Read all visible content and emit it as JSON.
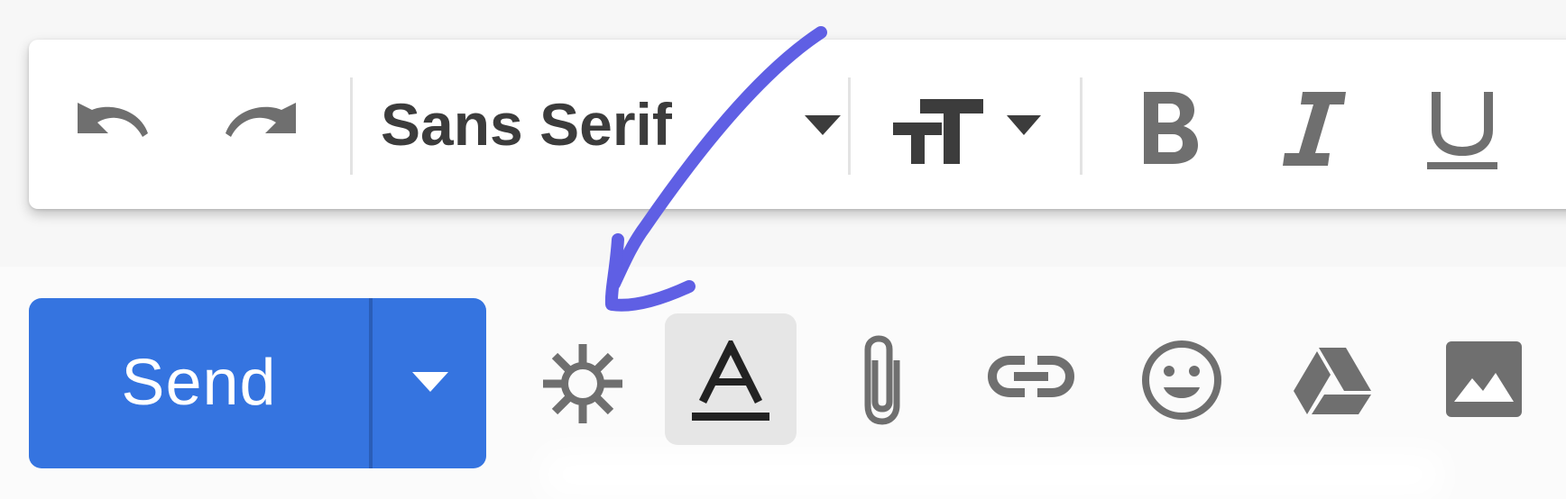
{
  "toolbar": {
    "undo_icon": "undo-icon",
    "redo_icon": "redo-icon",
    "font_family": "Sans Serif",
    "font_dropdown_icon": "caret-down-icon",
    "text_size_icon": "text-size-icon",
    "bold_icon": "bold-icon",
    "italic_icon": "italic-icon",
    "underline_icon": "underline-icon"
  },
  "compose_actions": {
    "send_label": "Send",
    "send_options_icon": "caret-down-icon",
    "items": [
      "ai-sparkle-icon",
      "text-color-icon",
      "attach-icon",
      "link-icon",
      "emoji-icon",
      "drive-icon",
      "image-icon"
    ]
  },
  "annotation": {
    "type": "hand-drawn-arrow",
    "color": "#5f5fe4",
    "points_to": "ai-sparkle-icon"
  },
  "colors": {
    "send_button": "#3574e0",
    "icon_gray": "#6f6f6f",
    "toolbar_text": "#3c3c3c",
    "selected_bg": "#e6e6e6",
    "annotation": "#5f5fe4"
  }
}
